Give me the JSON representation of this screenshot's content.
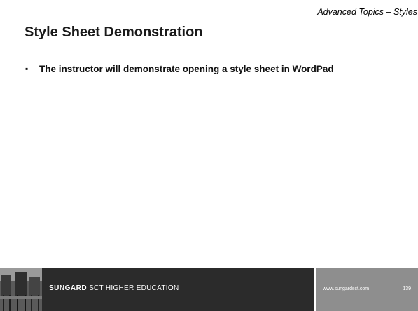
{
  "slide": {
    "section_header": "Advanced Topics – Styles",
    "title": "Style Sheet Demonstration",
    "bullets": [
      "The instructor will demonstrate opening a style sheet in WordPad"
    ]
  },
  "footer": {
    "brand_strong": "SUNGARD",
    "brand_rest": "SCT HIGHER EDUCATION",
    "url": "www.sungardsct.com",
    "page_number": "139"
  },
  "colors": {
    "footer_left_bg": "#2b2b2b",
    "footer_right_bg": "#8e8e8e",
    "title_text": "#1a1a1a"
  }
}
